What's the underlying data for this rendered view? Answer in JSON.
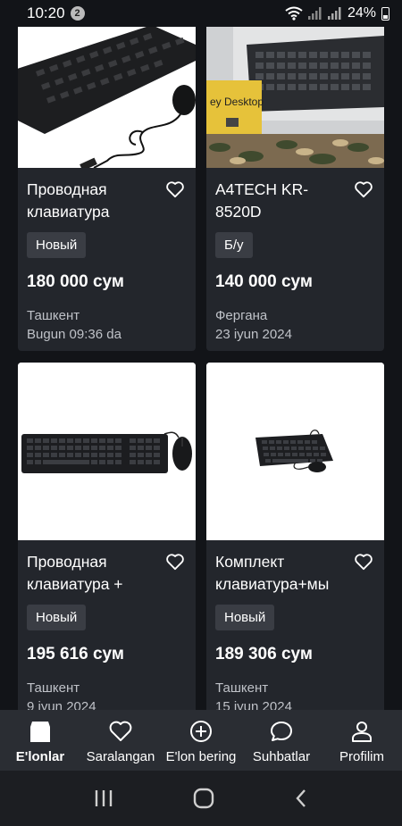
{
  "status": {
    "time": "10:20",
    "notifications": "2",
    "battery": "24%"
  },
  "listings": [
    {
      "title": "Проводная клавиатура",
      "condition": "Новый",
      "price": "180 000 сум",
      "city": "Ташкент",
      "date": "Bugun 09:36 da"
    },
    {
      "title": "A4TECH KR-8520D",
      "condition": "Б/у",
      "price": "140 000 сум",
      "city": "Фергана",
      "date": "23 iyun 2024",
      "image_label": "ey Desktop"
    },
    {
      "title": "Проводная клавиатура +",
      "condition": "Новый",
      "price": "195 616 сум",
      "city": "Ташкент",
      "date": "9 iyun 2024"
    },
    {
      "title": "Комплект клавиатура+мы",
      "condition": "Новый",
      "price": "189 306 сум",
      "city": "Ташкент",
      "date": "15 iyun 2024"
    }
  ],
  "bottom_nav": [
    {
      "label": "E'lonlar",
      "icon": "home-icon",
      "active": true
    },
    {
      "label": "Saralangan",
      "icon": "heart-icon",
      "active": false
    },
    {
      "label": "E'lon bering",
      "icon": "plus-circle-icon",
      "active": false
    },
    {
      "label": "Suhbatlar",
      "icon": "chat-icon",
      "active": false
    },
    {
      "label": "Profilim",
      "icon": "user-icon",
      "active": false
    }
  ],
  "system_nav": [
    "recents-icon",
    "home-button-icon",
    "back-icon"
  ]
}
